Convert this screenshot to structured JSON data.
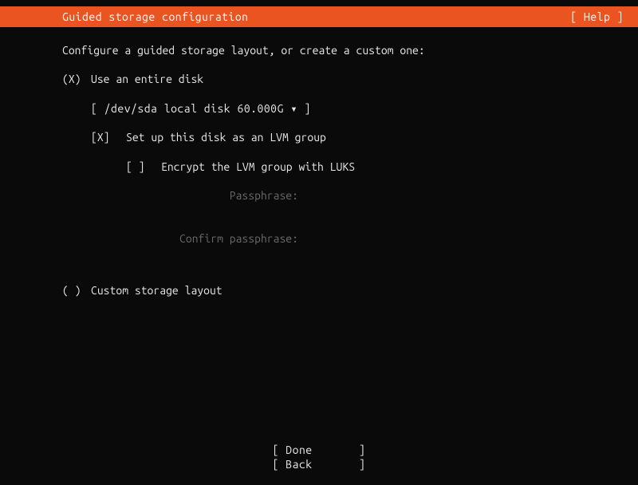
{
  "header": {
    "title": "Guided storage configuration",
    "help": "[ Help ]"
  },
  "instruction": "Configure a guided storage layout, or create a custom one:",
  "options": {
    "entire_disk": {
      "marker": "(X)",
      "label": "Use an entire disk"
    },
    "disk_selector": "[ /dev/sda local disk 60.000G ▾ ]",
    "lvm": {
      "marker": "[X]",
      "label": "Set up this disk as an LVM group"
    },
    "encrypt": {
      "marker": "[ ]",
      "label": "Encrypt the LVM group with LUKS"
    },
    "passphrase_label": "Passphrase:",
    "confirm_passphrase_label": "Confirm passphrase:",
    "custom": {
      "marker": "( )",
      "label": "Custom storage layout"
    }
  },
  "footer": {
    "done": "[ Done       ]",
    "back": "[ Back       ]"
  }
}
